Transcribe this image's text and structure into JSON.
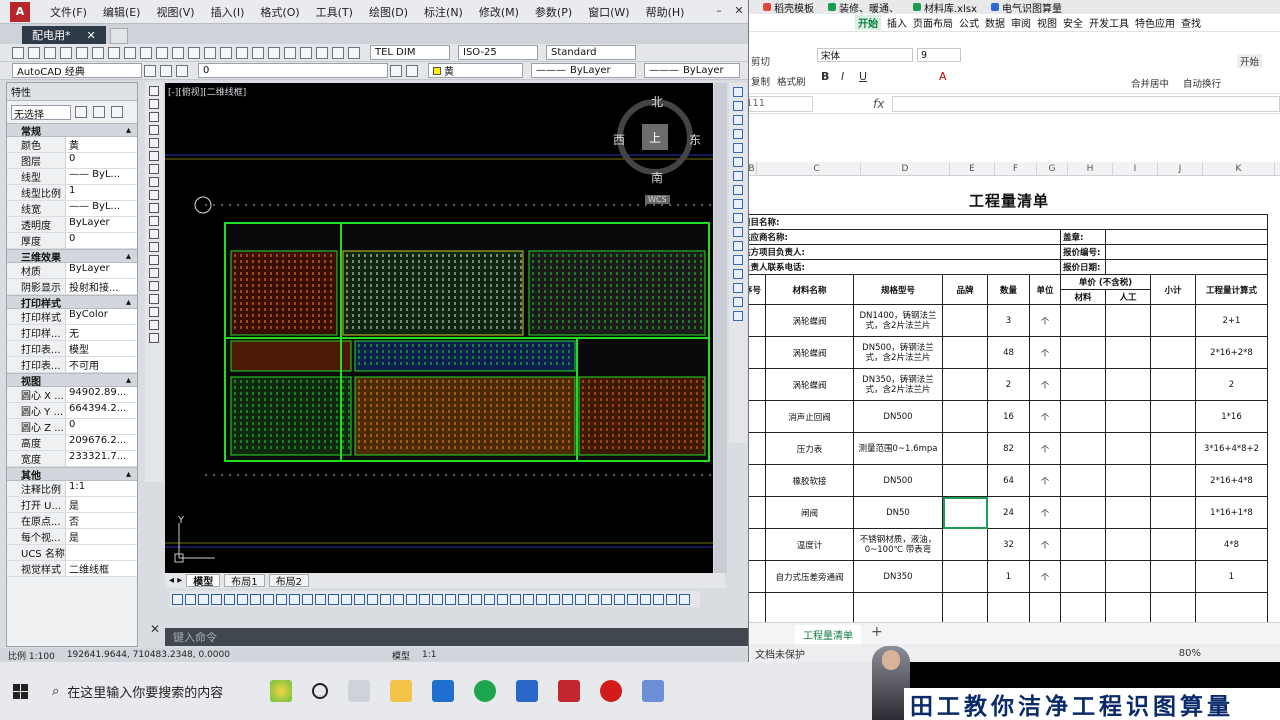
{
  "cad": {
    "menu": [
      "文件(F)",
      "编辑(E)",
      "视图(V)",
      "插入(I)",
      "格式(O)",
      "工具(T)",
      "绘图(D)",
      "标注(N)",
      "修改(M)",
      "参数(P)",
      "窗口(W)",
      "帮助(H)"
    ],
    "doc_tab": "配电用*",
    "workspace": "AutoCAD 经典",
    "text_style": "TEL DIM",
    "dim_style": "ISO-25",
    "table_style": "Standard",
    "layer": "0",
    "color": "黄",
    "linetype": "ByLayer",
    "lineweight": "ByLayer",
    "viewport_label": "[-][俯视][二维线框]",
    "compass": {
      "n": "北",
      "s": "南",
      "e": "东",
      "w": "西",
      "center": "上",
      "wcs": "WCS"
    },
    "axis_y": "Y",
    "layout_tabs": [
      "模型",
      "布局1",
      "布局2"
    ],
    "command_placeholder": "键入命令",
    "status": {
      "scale": "比例 1:100",
      "coords": "192641.9644, 710483.2348, 0.0000",
      "model": "模型",
      "zoom": "1:1"
    },
    "properties": {
      "title": "特性",
      "selection": "无选择",
      "groups": [
        {
          "name": "常规",
          "rows": [
            [
              "颜色",
              "黄"
            ],
            [
              "图层",
              "0"
            ],
            [
              "线型",
              "—— ByL..."
            ],
            [
              "线型比例",
              "1"
            ],
            [
              "线宽",
              "—— ByL..."
            ],
            [
              "透明度",
              "ByLayer"
            ],
            [
              "厚度",
              "0"
            ]
          ]
        },
        {
          "name": "三维效果",
          "rows": [
            [
              "材质",
              "ByLayer"
            ],
            [
              "阴影显示",
              "投射和接..."
            ]
          ]
        },
        {
          "name": "打印样式",
          "rows": [
            [
              "打印样式",
              "ByColor"
            ],
            [
              "打印样...",
              "无"
            ],
            [
              "打印表...",
              "模型"
            ],
            [
              "打印表...",
              "不可用"
            ]
          ]
        },
        {
          "name": "视图",
          "rows": [
            [
              "圆心 X ...",
              "94902.89..."
            ],
            [
              "圆心 Y ...",
              "664394.2..."
            ],
            [
              "圆心 Z ...",
              "0"
            ],
            [
              "高度",
              "209676.2..."
            ],
            [
              "宽度",
              "233321.7..."
            ]
          ]
        },
        {
          "name": "其他",
          "rows": [
            [
              "注释比例",
              "1:1"
            ],
            [
              "打开 U...",
              "是"
            ],
            [
              "在原点...",
              "否"
            ],
            [
              "每个视...",
              "是"
            ],
            [
              "UCS 名称",
              ""
            ],
            [
              "视觉样式",
              "二维线框"
            ]
          ]
        }
      ]
    }
  },
  "spreadsheet": {
    "file_tabs": [
      "稻壳模板",
      "装修、暖通、",
      "材料库.xlsx",
      "电气识图算量"
    ],
    "ribbon_tabs": [
      "开始",
      "插入",
      "页面布局",
      "公式",
      "数据",
      "审阅",
      "视图",
      "安全",
      "开发工具",
      "特色应用",
      "查找"
    ],
    "font_name": "宋体",
    "font_size": "9",
    "ribbon_labels": {
      "paste": "剪切",
      "copy": "复制",
      "format": "格式刷",
      "merge": "合并居中",
      "wrap": "自动换行",
      "start": "开始"
    },
    "name_box": "111",
    "fx": "fx",
    "columns": [
      "B",
      "C",
      "D",
      "E",
      "F",
      "G",
      "H",
      "I",
      "J",
      "K"
    ],
    "sheet_title": "工程量清单",
    "info": {
      "project": "项目名称:",
      "supplier": "供应商名称:",
      "supplier_manager": "供方项目负责人:",
      "contact": "负责人联系电话:",
      "stamp": "盖章:",
      "quote_no": "报价编号:",
      "quote_date": "报价日期:"
    },
    "headers": {
      "seq": "序号",
      "name": "材料名称",
      "spec": "规格型号",
      "brand": "品牌",
      "qty": "数量",
      "unit": "单位",
      "price": "单价 (不含税)",
      "material": "材料",
      "labor": "人工",
      "subtotal": "小计",
      "calc": "工程量计算式"
    },
    "rows": [
      {
        "name": "涡轮蝶阀",
        "spec": "DN1400，铸钢法兰式，含2片法兰片",
        "qty": "3",
        "unit": "个",
        "calc": "2+1"
      },
      {
        "name": "涡轮蝶阀",
        "spec": "DN500，铸钢法兰式，含2片法兰片",
        "qty": "48",
        "unit": "个",
        "calc": "2*16+2*8"
      },
      {
        "name": "涡轮蝶阀",
        "spec": "DN350，铸钢法兰式，含2片法兰片",
        "qty": "2",
        "unit": "个",
        "calc": "2"
      },
      {
        "name": "消声止回阀",
        "spec": "DN500",
        "qty": "16",
        "unit": "个",
        "calc": "1*16"
      },
      {
        "name": "压力表",
        "spec": "测量范围0~1.6mpa",
        "qty": "82",
        "unit": "个",
        "calc": "3*16+4*8+2"
      },
      {
        "name": "橡胶软接",
        "spec": "DN500",
        "qty": "64",
        "unit": "个",
        "calc": "2*16+4*8"
      },
      {
        "name": "闸阀",
        "spec": "DN50",
        "qty": "24",
        "unit": "个",
        "calc": "1*16+1*8"
      },
      {
        "name": "温度计",
        "spec": "不锈钢材质，液油，0~100℃ 带表弯",
        "qty": "32",
        "unit": "个",
        "calc": "4*8"
      },
      {
        "name": "自力式压差旁通阀",
        "spec": "DN350",
        "qty": "1",
        "unit": "个",
        "calc": "1"
      }
    ],
    "sheet_tab": "工程量清单",
    "status": "文档未保护",
    "zoom": "80%"
  },
  "taskbar": {
    "search": "在这里输入你要搜索的内容"
  },
  "banner": "田工教你洁净工程识图算量",
  "colors": {
    "cad_bg": "#000000",
    "accent_green": "#1d9b4e",
    "cad_red": "#b9262a"
  }
}
